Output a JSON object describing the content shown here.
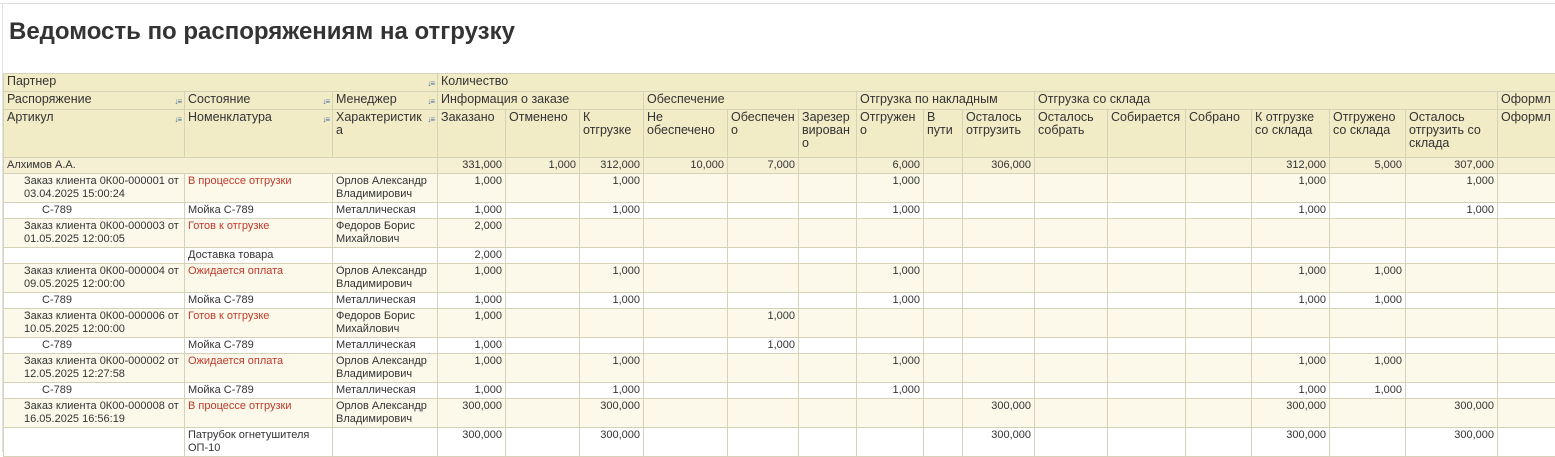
{
  "page_title": "Ведомость по распоряжениям на отгрузку",
  "headers": {
    "partner": "Партнер",
    "quantity": "Количество",
    "order_doc": "Распоряжение",
    "state": "Состояние",
    "manager": "Менеджер",
    "order_info": "Информация о заказе",
    "provision": "Обеспечение",
    "ship_invoice": "Отгрузка по накладным",
    "ship_warehouse": "Отгрузка со склада",
    "ofor": "Оформл",
    "article": "Артикул",
    "nomenclature": "Номенклатура",
    "characteristic": "Характеристика",
    "ordered": "Заказано",
    "canceled": "Отменено",
    "to_ship": "К отгрузке",
    "not_provided": "Не обеспечено",
    "provided": "Обеспечено",
    "reserved": "Зарезервировано",
    "shipped": "Отгружено",
    "in_transit": "В пути",
    "left_ship": "Осталось отгрузить",
    "left_collect": "Осталось собрать",
    "collecting": "Собирается",
    "collected": "Собрано",
    "to_ship_wh": "К отгрузке со склада",
    "shipped_wh": "Отгружено со склада",
    "left_ship_wh": "Осталось отгрузить со склада",
    "ofor2": "Оформл"
  },
  "group": {
    "name": "Алхимов А.А.",
    "vals": [
      "331,000",
      "1,000",
      "312,000",
      "10,000",
      "7,000",
      "",
      "6,000",
      "",
      "306,000",
      "",
      "",
      "",
      "312,000",
      "5,000",
      "307,000",
      ""
    ]
  },
  "rows": [
    {
      "type": "doc",
      "c1": "Заказ клиента 0К00-000001 от 03.04.2025 15:00:24",
      "c2": "В процессе отгрузки",
      "c3": "Орлов Александр Владимирович",
      "vals": [
        "1,000",
        "",
        "1,000",
        "",
        "",
        "",
        "1,000",
        "",
        "",
        "",
        "",
        "",
        "1,000",
        "",
        "1,000",
        ""
      ]
    },
    {
      "type": "item",
      "c1": "С-789",
      "c2": "Мойка С-789",
      "c3": "Металлическая",
      "vals": [
        "1,000",
        "",
        "1,000",
        "",
        "",
        "",
        "1,000",
        "",
        "",
        "",
        "",
        "",
        "1,000",
        "",
        "1,000",
        ""
      ]
    },
    {
      "type": "doc",
      "c1": "Заказ клиента 0К00-000003 от 01.05.2025 12:00:05",
      "c2": "Готов к отгрузке",
      "c3": "Федоров Борис Михайлович",
      "vals": [
        "2,000",
        "",
        "",
        "",
        "",
        "",
        "",
        "",
        "",
        "",
        "",
        "",
        "",
        "",
        "",
        ""
      ]
    },
    {
      "type": "item",
      "c1": "",
      "c2": "Доставка товара",
      "c3": "",
      "vals": [
        "2,000",
        "",
        "",
        "",
        "",
        "",
        "",
        "",
        "",
        "",
        "",
        "",
        "",
        "",
        "",
        ""
      ]
    },
    {
      "type": "doc",
      "c1": "Заказ клиента 0К00-000004 от 09.05.2025 12:00:00",
      "c2": "Ожидается оплата",
      "c3": "Орлов Александр Владимирович",
      "vals": [
        "1,000",
        "",
        "1,000",
        "",
        "",
        "",
        "1,000",
        "",
        "",
        "",
        "",
        "",
        "1,000",
        "1,000",
        "",
        ""
      ]
    },
    {
      "type": "item",
      "c1": "С-789",
      "c2": "Мойка С-789",
      "c3": "Металлическая",
      "vals": [
        "1,000",
        "",
        "1,000",
        "",
        "",
        "",
        "1,000",
        "",
        "",
        "",
        "",
        "",
        "1,000",
        "1,000",
        "",
        ""
      ]
    },
    {
      "type": "doc",
      "c1": "Заказ клиента 0К00-000006 от 10.05.2025 12:00:00",
      "c2": "Готов к отгрузке",
      "c3": "Федоров Борис Михайлович",
      "vals": [
        "1,000",
        "",
        "",
        "",
        "1,000",
        "",
        "",
        "",
        "",
        "",
        "",
        "",
        "",
        "",
        "",
        ""
      ]
    },
    {
      "type": "item",
      "c1": "С-789",
      "c2": "Мойка С-789",
      "c3": "Металлическая",
      "vals": [
        "1,000",
        "",
        "",
        "",
        "1,000",
        "",
        "",
        "",
        "",
        "",
        "",
        "",
        "",
        "",
        "",
        ""
      ]
    },
    {
      "type": "doc",
      "c1": "Заказ клиента 0К00-000002 от 12.05.2025 12:27:58",
      "c2": "Ожидается оплата",
      "c3": "Орлов Александр Владимирович",
      "vals": [
        "1,000",
        "",
        "1,000",
        "",
        "",
        "",
        "1,000",
        "",
        "",
        "",
        "",
        "",
        "1,000",
        "1,000",
        "",
        ""
      ]
    },
    {
      "type": "item",
      "c1": "С-789",
      "c2": "Мойка С-789",
      "c3": "Металлическая",
      "vals": [
        "1,000",
        "",
        "1,000",
        "",
        "",
        "",
        "1,000",
        "",
        "",
        "",
        "",
        "",
        "1,000",
        "1,000",
        "",
        ""
      ]
    },
    {
      "type": "doc",
      "c1": "Заказ клиента 0К00-000008 от 16.05.2025 16:56:19",
      "c2": "В процессе отгрузки",
      "c3": "Орлов Александр Владимирович",
      "vals": [
        "300,000",
        "",
        "300,000",
        "",
        "",
        "",
        "",
        "",
        "300,000",
        "",
        "",
        "",
        "300,000",
        "",
        "300,000",
        ""
      ]
    },
    {
      "type": "item",
      "c1": "",
      "c2": "Патрубок огнетушителя ОП-10",
      "c3": "",
      "vals": [
        "300,000",
        "",
        "300,000",
        "",
        "",
        "",
        "",
        "",
        "300,000",
        "",
        "",
        "",
        "300,000",
        "",
        "300,000",
        ""
      ]
    }
  ]
}
